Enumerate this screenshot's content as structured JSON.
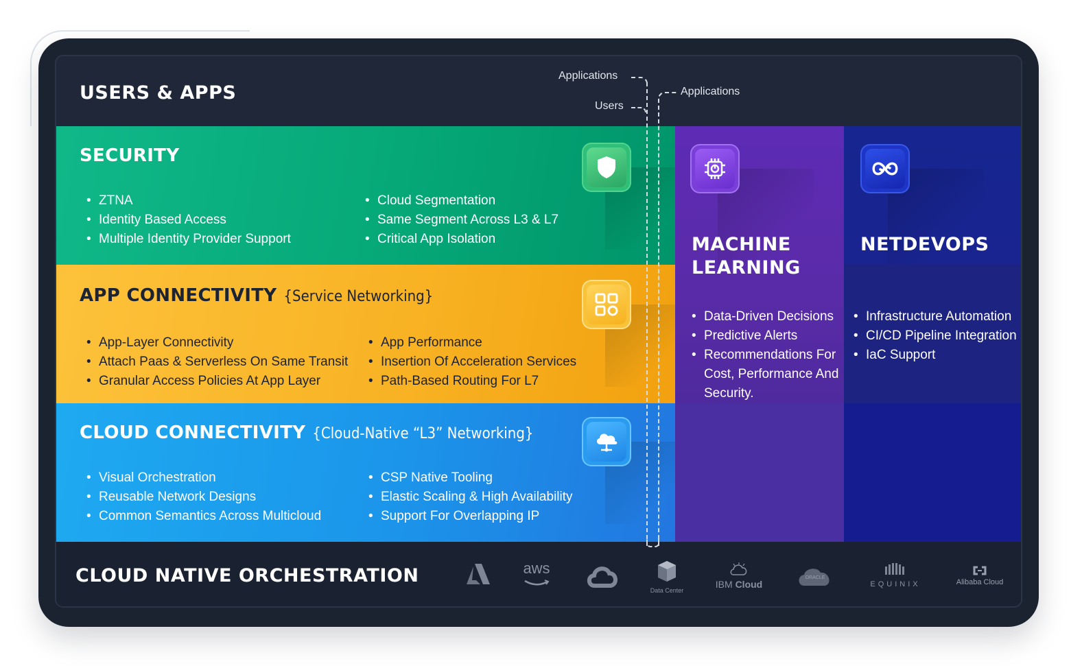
{
  "top": {
    "title": "USERS & APPS"
  },
  "connector": {
    "label_applications_left": "Applications",
    "label_users": "Users",
    "label_applications_right": "Applications"
  },
  "security": {
    "title": "SECURITY",
    "left_items": [
      "ZTNA",
      "Identity Based Access",
      "Multiple Identity Provider Support"
    ],
    "right_items": [
      "Cloud Segmentation",
      "Same Segment Across L3 & L7",
      "Critical App Isolation"
    ],
    "icon": "shield-icon"
  },
  "app": {
    "title": "APP CONNECTIVITY",
    "subtitle": "{Service Networking}",
    "left_items": [
      "App-Layer Connectivity",
      "Attach Paas & Serverless On Same Transit",
      "Granular Access Policies At App Layer"
    ],
    "right_items": [
      "App Performance",
      "Insertion Of Acceleration Services",
      "Path-Based Routing For L7"
    ],
    "icon": "grid-icon"
  },
  "cloud": {
    "title": "CLOUD CONNECTIVITY",
    "subtitle": "{Cloud-Native “L3” Networking}",
    "left_items": [
      "Visual Orchestration",
      "Reusable Network Designs",
      "Common Semantics Across Multicloud"
    ],
    "right_items": [
      "CSP Native Tooling",
      "Elastic Scaling & High Availability",
      "Support For Overlapping IP"
    ],
    "icon": "cloud-network-icon"
  },
  "ml": {
    "title_line1": "MACHINE",
    "title_line2": "LEARNING",
    "items": [
      "Data-Driven Decisions",
      "Predictive Alerts",
      "Recommendations For",
      "Cost, Performance And",
      "Security."
    ],
    "icon": "chip-icon"
  },
  "netdevops": {
    "title": "NETDEVOPS",
    "items": [
      "Infrastructure Automation",
      "CI/CD Pipeline Integration",
      "IaC Support"
    ],
    "icon": "infinity-icon"
  },
  "bottom": {
    "title": "CLOUD NATIVE ORCHESTRATION",
    "logos": {
      "aws": "aws",
      "datacenter": "Data Center",
      "ibm_1": "IBM",
      "ibm_2": "Cloud",
      "oracle": "ORACLE",
      "equinix": "EQUINIX",
      "alibaba": "Alibaba Cloud"
    }
  }
}
